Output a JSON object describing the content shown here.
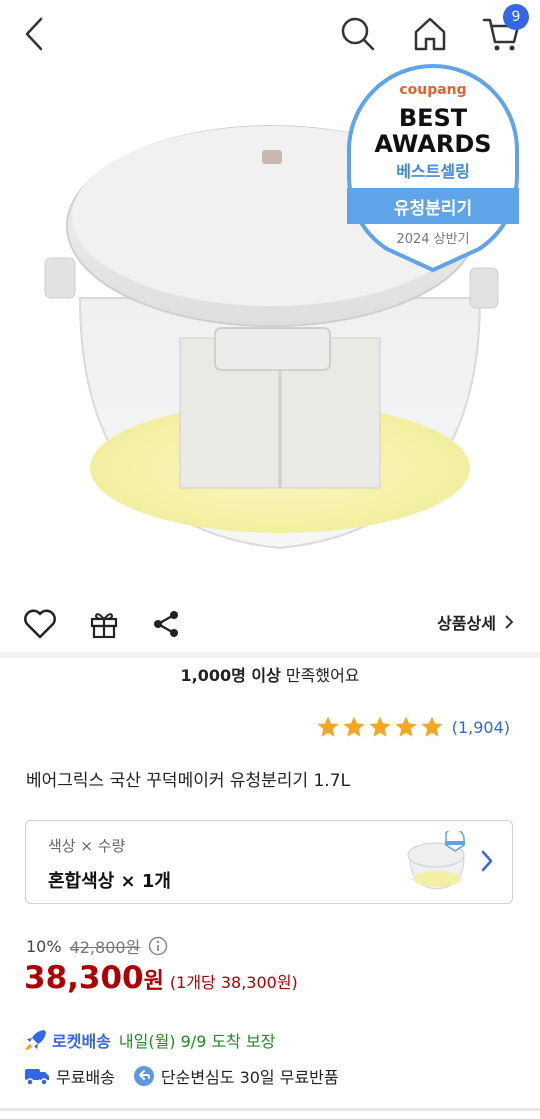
{
  "header": {
    "back_icon": "chevron-left-icon",
    "search_icon": "search-icon",
    "home_icon": "home-icon",
    "cart_icon": "cart-icon",
    "cart_count": "9",
    "accent_color": "#3467e6"
  },
  "award": {
    "brand": "coupang",
    "line1": "BEST",
    "line2": "AWARDS",
    "line3": "베스트셀링",
    "category": "유청분리기",
    "period": "2024 상반기"
  },
  "actions": {
    "heart_icon": "heart-icon",
    "gift_icon": "gift-icon",
    "share_icon": "share-icon",
    "detail_label": "상품상세"
  },
  "satisfaction": {
    "count": "1,000명 이상",
    "suffix": " 만족했어요"
  },
  "rating": {
    "stars": 5,
    "review_count": "(1,904)",
    "star_color": "#f5a623"
  },
  "product": {
    "title": "베어그릭스 국산 꾸덕메이커 유청분리기 1.7L"
  },
  "option": {
    "label": "색상 × 수량",
    "value": "혼합색상 × 1개"
  },
  "price": {
    "discount": "10%",
    "original": "42,800원",
    "sale": "38,300",
    "currency": "원",
    "unit_price": "(1개당 38,300원)",
    "price_color": "#ae0000"
  },
  "delivery": {
    "rocket_label": "로켓배송",
    "eta": "내일(월) 9/9 도착 보장",
    "free_shipping": "무료배송",
    "return_policy": "단순변심도 30일 무료반품"
  }
}
